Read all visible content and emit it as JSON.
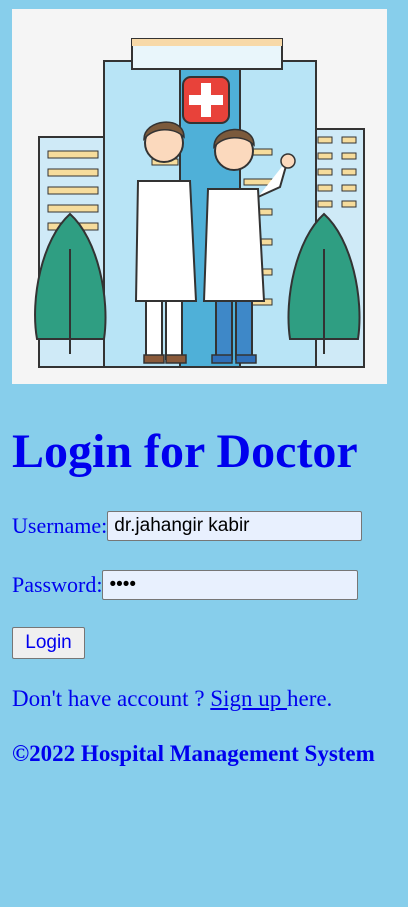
{
  "hero_image": {
    "icon": "doctors-hospital-illustration",
    "colors": {
      "building": "#a8dcf0",
      "tree": "#2f9e82",
      "cross": "#e8423a"
    }
  },
  "page_title": "Login for Doctor",
  "form": {
    "username_label": "Username:",
    "username_value": "dr.jahangir kabir",
    "password_label": "Password:",
    "password_value": "1234",
    "login_label": "Login"
  },
  "signup": {
    "prefix": "Don't have account ? ",
    "link": "Sign up ",
    "suffix": "here."
  },
  "footer": "©2022 Hospital Management System",
  "colors": {
    "background": "#87ceeb",
    "text": "#0000ee",
    "input_bg": "#e8f0fe"
  }
}
